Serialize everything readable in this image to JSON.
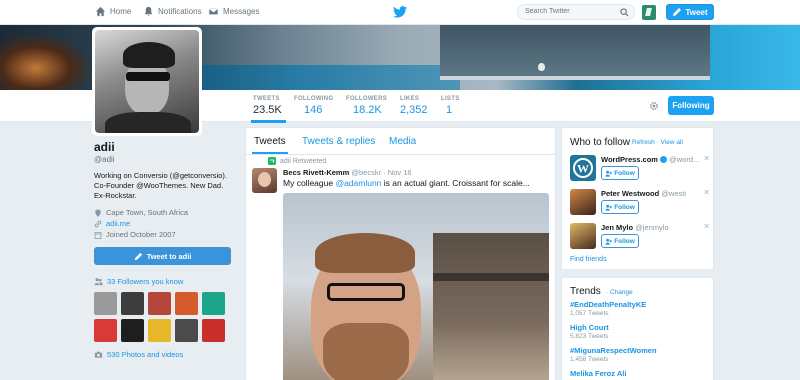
{
  "topnav": {
    "home": "Home",
    "notifications": "Notifications",
    "messages": "Messages",
    "search_placeholder": "Search Twitter",
    "tweet_button": "Tweet"
  },
  "profile_nav": {
    "stats": [
      {
        "label": "TWEETS",
        "value": "23.5K"
      },
      {
        "label": "FOLLOWING",
        "value": "146"
      },
      {
        "label": "FOLLOWERS",
        "value": "18.2K"
      },
      {
        "label": "LIKES",
        "value": "2,352"
      },
      {
        "label": "LISTS",
        "value": "1"
      }
    ],
    "following_button": "Following"
  },
  "profile": {
    "name": "adii",
    "handle": "@adii",
    "bio_line1": "Working on Conversio (@getconversio).",
    "bio_line2": "Co-Founder @WooThemes. New Dad.",
    "bio_line3": "Ex-Rockstar.",
    "location": "Cape Town, South Africa",
    "website": "adii.me",
    "joined": "Joined October 2007",
    "tweet_to": "Tweet to adii",
    "followers_you_know": "33 Followers you know",
    "photos_videos": "530 Photos and videos"
  },
  "known_followers_colors": [
    "#9a9a9a",
    "#3d3d3d",
    "#b5463a",
    "#d65b2a",
    "#1ba68a",
    "#d83a3a",
    "#1e1e1e",
    "#e6b82a",
    "#4b4b4b",
    "#c9302c"
  ],
  "timeline": {
    "tabs": [
      "Tweets",
      "Tweets & replies",
      "Media"
    ],
    "retweet_label": "adii Retweeted",
    "tweet_author": "Becs Rivett-Kemm",
    "tweet_handle": "@becskr",
    "tweet_date": "Nov 16",
    "tweet_prefix": "My colleague ",
    "tweet_mention": "@adamlunn",
    "tweet_suffix": " is an actual giant. Croissant for scale..."
  },
  "who_to_follow": {
    "title": "Who to follow",
    "refresh": "Refresh",
    "view_all": "View all",
    "follow_label": "Follow",
    "find_friends": "Find friends",
    "users": [
      {
        "name": "WordPress.com",
        "handle": "@word..."
      },
      {
        "name": "Peter Westwood",
        "handle": "@westi"
      },
      {
        "name": "Jen Mylo",
        "handle": "@jenmylo"
      }
    ]
  },
  "trends": {
    "title": "Trends",
    "change": "Change",
    "items": [
      {
        "tag": "#EndDeathPenaltyKE",
        "count": "1,057 Tweets"
      },
      {
        "tag": "High Court",
        "count": "5,823 Tweets"
      },
      {
        "tag": "#MigunaRespectWomen",
        "count": "1,458 Tweets"
      },
      {
        "tag": "Melika Feroz Ali",
        "count": ""
      }
    ]
  },
  "colors": {
    "accent": "#1da1f2",
    "link": "#1b95e0",
    "background": "#e8edf1"
  }
}
